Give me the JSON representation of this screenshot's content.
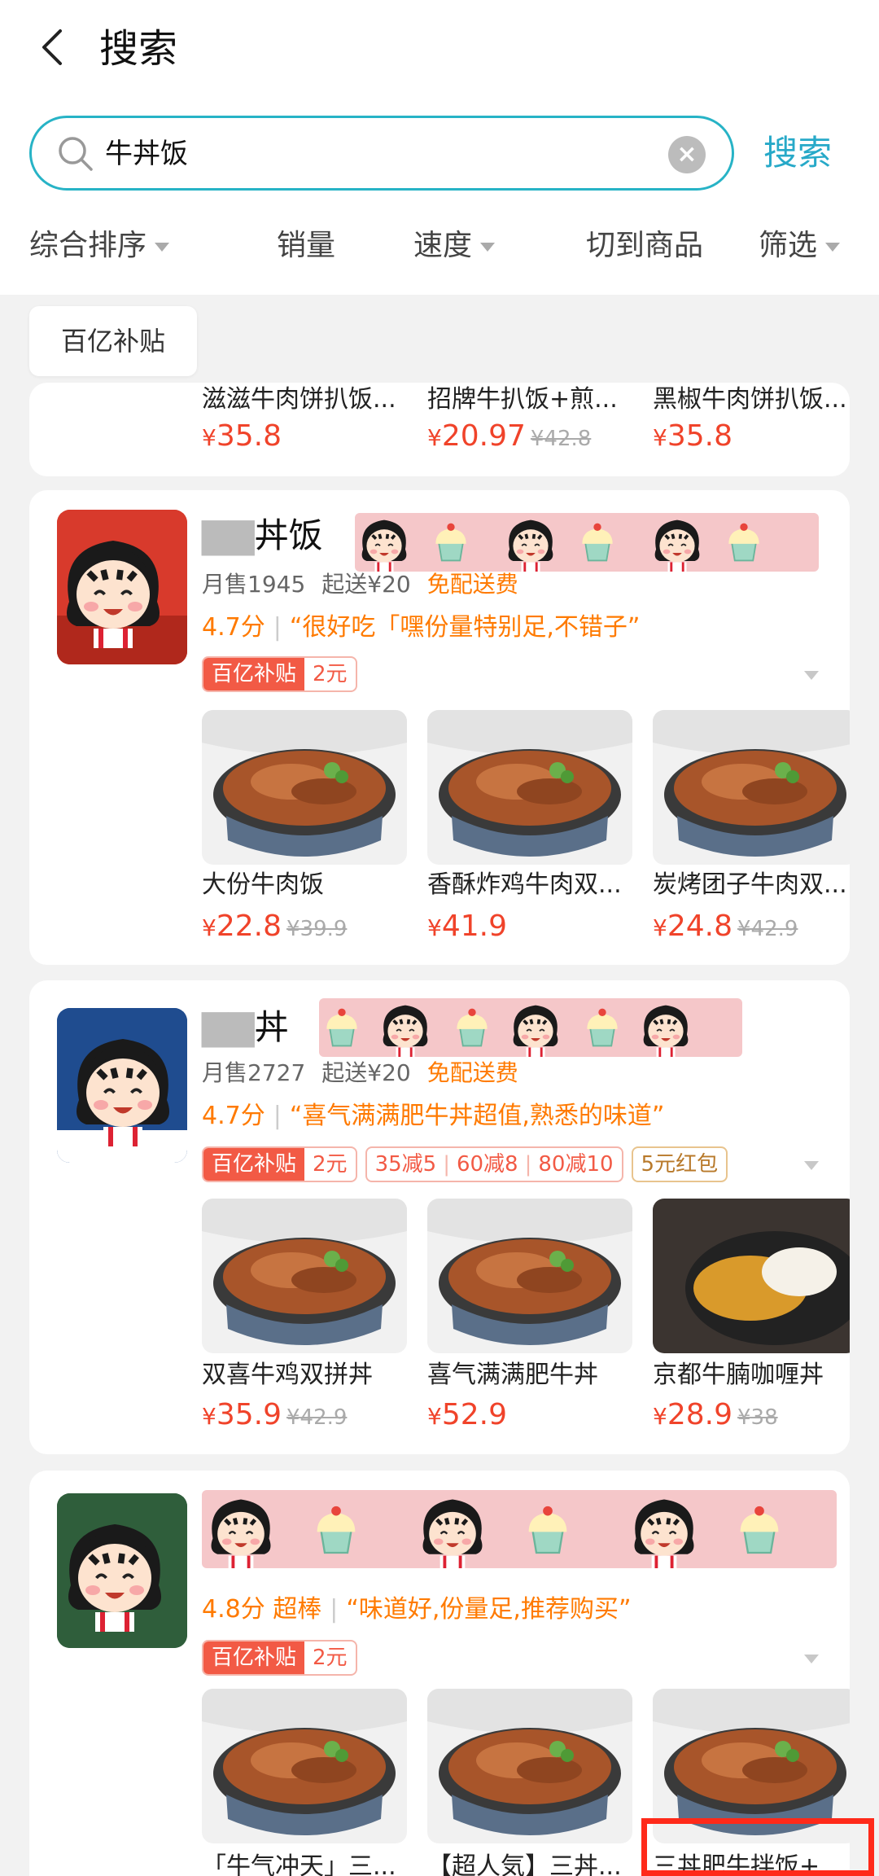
{
  "header": {
    "title": "搜索"
  },
  "search": {
    "query": "牛丼饭",
    "submit_label": "搜索"
  },
  "sort_tabs": [
    "综合排序",
    "销量",
    "速度",
    "切到商品",
    "筛选"
  ],
  "filter_chip": "百亿补贴",
  "colors": {
    "accent": "#27b3c6",
    "price": "#f0432a",
    "orange": "#ff7a00"
  },
  "stores": [
    {
      "items": [
        {
          "name": "滋滋牛肉饼扒饭...",
          "price": "35.8",
          "original": ""
        },
        {
          "name": "招牌牛扒饭+煎...",
          "price": "20.97",
          "original": "¥42.8"
        },
        {
          "name": "黑椒牛肉饼扒饭...",
          "price": "35.8",
          "original": ""
        }
      ]
    },
    {
      "name": "丼饭",
      "monthly_sales": "月售1945",
      "min_order": "起送¥20",
      "delivery": "免配送费",
      "rating": "4.7分",
      "review": "“很好吃「嘿份量特别足,不错子”",
      "promo_label": "百亿补贴",
      "promo_amount": "2元",
      "items": [
        {
          "name": "大份牛肉饭",
          "price": "22.8",
          "original": "¥39.9"
        },
        {
          "name": "香酥炸鸡牛肉双...",
          "price": "41.9",
          "original": ""
        },
        {
          "name": "炭烤团子牛肉双...",
          "price": "24.8",
          "original": "¥42.9"
        }
      ]
    },
    {
      "name": "丼",
      "monthly_sales": "月售2727",
      "min_order": "起送¥20",
      "delivery": "免配送费",
      "rating": "4.7分",
      "review": "“喜气满满肥牛丼超值,熟悉的味道”",
      "promo_label": "百亿补贴",
      "promo_amount": "2元",
      "discounts": [
        "35减5",
        "60减8",
        "80减10"
      ],
      "red_packet": "5元红包",
      "items": [
        {
          "name": "双喜牛鸡双拼丼",
          "price": "35.9",
          "original": "¥42.9"
        },
        {
          "name": "喜气满满肥牛丼",
          "price": "52.9",
          "original": ""
        },
        {
          "name": "京都牛腩咖喱丼",
          "price": "28.9",
          "original": "¥38"
        }
      ]
    },
    {
      "rating": "4.8分 超棒",
      "review": "“味道好,份量足,推荐购买”",
      "promo_label": "百亿补贴",
      "promo_amount": "2元",
      "items": [
        {
          "name": "「牛气冲天」三...",
          "price": "",
          "original": ""
        },
        {
          "name": "【超人気】三丼...",
          "price": "",
          "original": ""
        },
        {
          "name": "三丼肥牛拌饭+...",
          "price": "",
          "original": ""
        }
      ]
    }
  ]
}
